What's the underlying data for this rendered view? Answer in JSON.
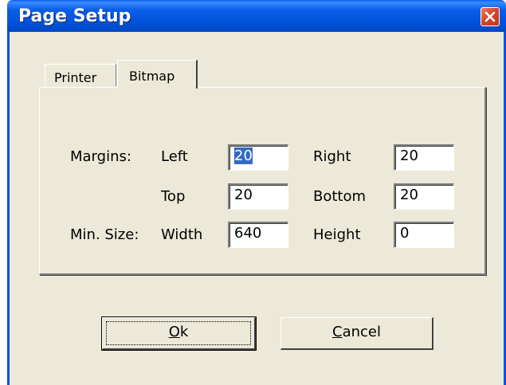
{
  "window": {
    "title": "Page Setup"
  },
  "titlebar": {
    "close_icon": "close-icon",
    "close_color": "#d7452a",
    "title_color": "#ffffff",
    "bar_color": "#0054e3"
  },
  "tabs": [
    {
      "label": "Printer",
      "selected": false
    },
    {
      "label": "Bitmap",
      "selected": true
    }
  ],
  "form": {
    "margins_label": "Margins:",
    "min_size_label": "Min. Size:",
    "left_label": "Left",
    "right_label": "Right",
    "top_label": "Top",
    "bottom_label": "Bottom",
    "width_label": "Width",
    "height_label": "Height",
    "left_value": "20",
    "right_value": "20",
    "top_value": "20",
    "bottom_value": "20",
    "width_value": "640",
    "height_value": "0"
  },
  "buttons": {
    "ok_mnemonic": "O",
    "ok_rest": "k",
    "cancel_mnemonic": "C",
    "cancel_rest": "ancel"
  },
  "colors": {
    "dialog_face": "#ece9d8",
    "selection": "#316ac5"
  }
}
